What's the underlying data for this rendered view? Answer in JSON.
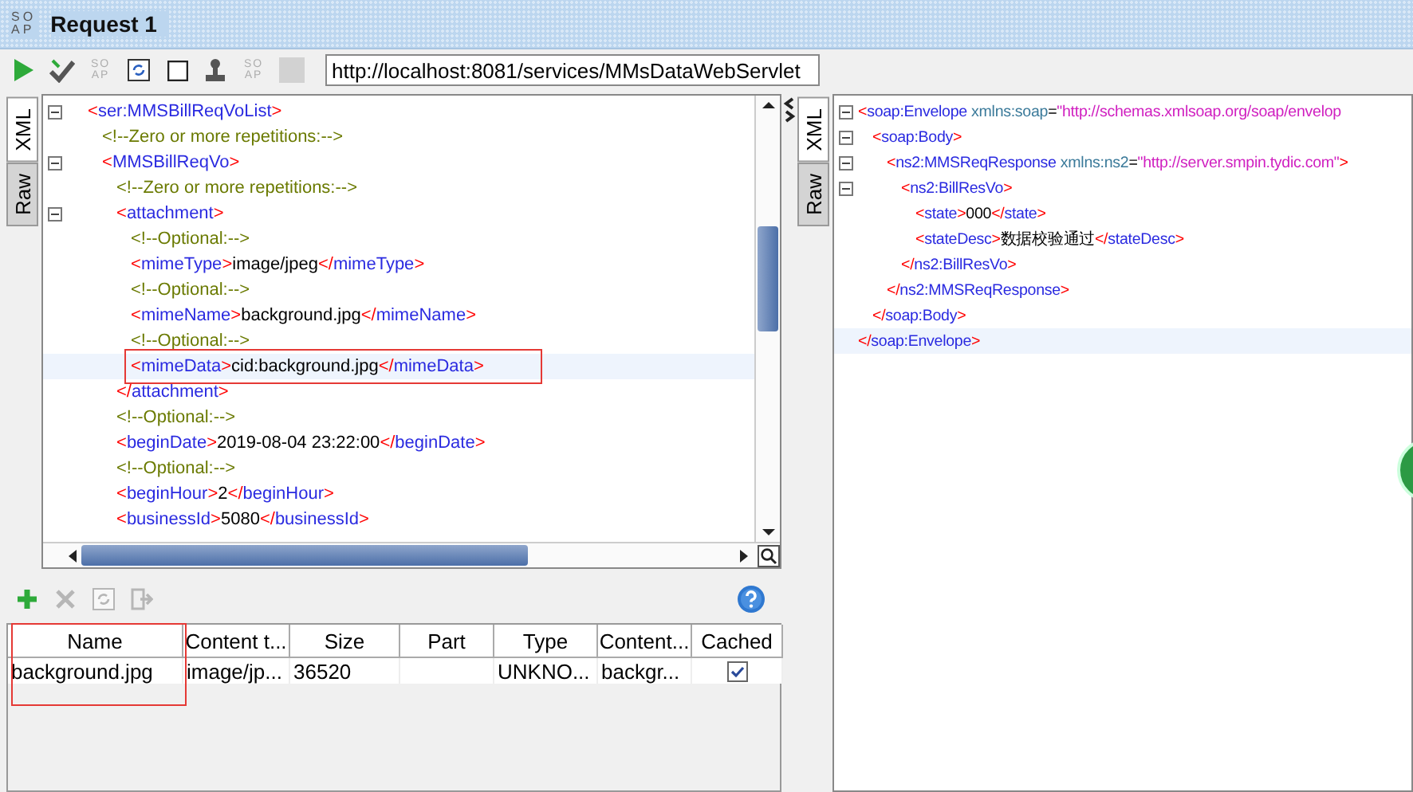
{
  "window": {
    "logo": [
      "SO",
      "AP"
    ],
    "title": "Request 1"
  },
  "toolbar": {
    "buttons": [
      {
        "kind": "run",
        "disabled": false
      },
      {
        "kind": "validate",
        "disabled": false
      },
      {
        "kind": "soap",
        "glyph": [
          "SO",
          "AP"
        ],
        "disabled": true
      },
      {
        "kind": "refresh",
        "disabled": false
      },
      {
        "kind": "square",
        "disabled": false
      },
      {
        "kind": "stamp",
        "disabled": false
      },
      {
        "kind": "soap",
        "glyph": [
          "SO",
          "AP"
        ],
        "disabled": true
      },
      {
        "kind": "stop",
        "disabled": true
      }
    ],
    "url": "http://localhost:8081/services/MMsDataWebServlet"
  },
  "request_pane": {
    "tabs": [
      {
        "label": "XML",
        "selected": true
      },
      {
        "label": "Raw",
        "selected": false
      }
    ],
    "lines": [
      {
        "tag": "<ser:MMSBillReqVoList>",
        "expanded": true,
        "children": [
          {
            "comment": "<!--Zero or more repetitions:-->"
          },
          {
            "tag": "<MMSBillReqVo>",
            "expanded": true,
            "children": [
              {
                "comment": "<!--Zero or more repetitions:-->"
              },
              {
                "tag": "<attachment>",
                "expanded": true,
                "children": [
                  {
                    "comment": "<!--Optional:-->"
                  },
                  {
                    "tag": "<mimeType>",
                    "value": "image/jpeg",
                    "close": "</mimeType>"
                  },
                  {
                    "comment": "<!--Optional:-->"
                  },
                  {
                    "tag": "<mimeName>",
                    "value": "background.jpg",
                    "close": "</mimeName>"
                  },
                  {
                    "comment": "<!--Optional:-->"
                  },
                  {
                    "tag": "<mimeData>",
                    "value": "cid:background.jpg",
                    "close": "</mimeData>",
                    "current": true,
                    "marked": true
                  }
                ],
                "close": "</attachment>"
              },
              {
                "comment": "<!--Optional:-->"
              },
              {
                "tag": "<beginDate>",
                "value": "2019-08-04 23:22:00",
                "close": "</beginDate>"
              },
              {
                "comment": "<!--Optional:-->"
              },
              {
                "tag": "<beginHour>",
                "value": "2",
                "close": "</beginHour>"
              },
              {
                "tag": "<businessId>",
                "value": "5080",
                "close": "</businessId>"
              }
            ]
          }
        ]
      }
    ]
  },
  "attachments": {
    "tools": [
      {
        "kind": "add",
        "disabled": false
      },
      {
        "kind": "remove",
        "disabled": true
      },
      {
        "kind": "reload",
        "disabled": true
      },
      {
        "kind": "export",
        "disabled": true
      }
    ],
    "columns": [
      {
        "label": "Name",
        "marked": true
      },
      {
        "label": "Content t..."
      },
      {
        "label": "Size"
      },
      {
        "label": "Part"
      },
      {
        "label": "Type"
      },
      {
        "label": "Content..."
      },
      {
        "label": "Cached"
      }
    ],
    "rows": [
      {
        "name": "background.jpg",
        "content_type": "image/jp...",
        "size": "36520",
        "type": "UNKNO...",
        "content": "backgr...",
        "cached": true
      }
    ]
  },
  "response_pane": {
    "tabs": [
      {
        "label": "XML",
        "selected": true
      },
      {
        "label": "Raw",
        "selected": false
      }
    ],
    "lines": [
      {
        "tag": "<soap:Envelope",
        "attr": "xmlns:soap",
        "eq": "=",
        "attr_value": "\"http://schemas.xmlsoap.org/soap/envelop",
        "expanded": true,
        "children": [
          {
            "tag": "<soap:Body>",
            "expanded": true,
            "children": [
              {
                "tag": "<ns2:MMSReqResponse",
                "attr": "xmlns:ns2",
                "eq": "=",
                "attr_value": "\"http://server.smpin.tydic.com\"",
                "tag_end": ">",
                "expanded": true,
                "children": [
                  {
                    "tag": "<ns2:BillResVo>",
                    "expanded": true,
                    "children": [
                      {
                        "tag": "<state>",
                        "value": "000",
                        "close": "</state>"
                      },
                      {
                        "tag": "<stateDesc>",
                        "value": "数据校验通过",
                        "close": "</stateDesc>"
                      }
                    ],
                    "close": "</ns2:BillResVo>"
                  }
                ],
                "close": "</ns2:MMSReqResponse>"
              }
            ],
            "close": "</soap:Body>"
          }
        ],
        "close": "</soap:Envelope>",
        "close_current": true
      }
    ]
  }
}
